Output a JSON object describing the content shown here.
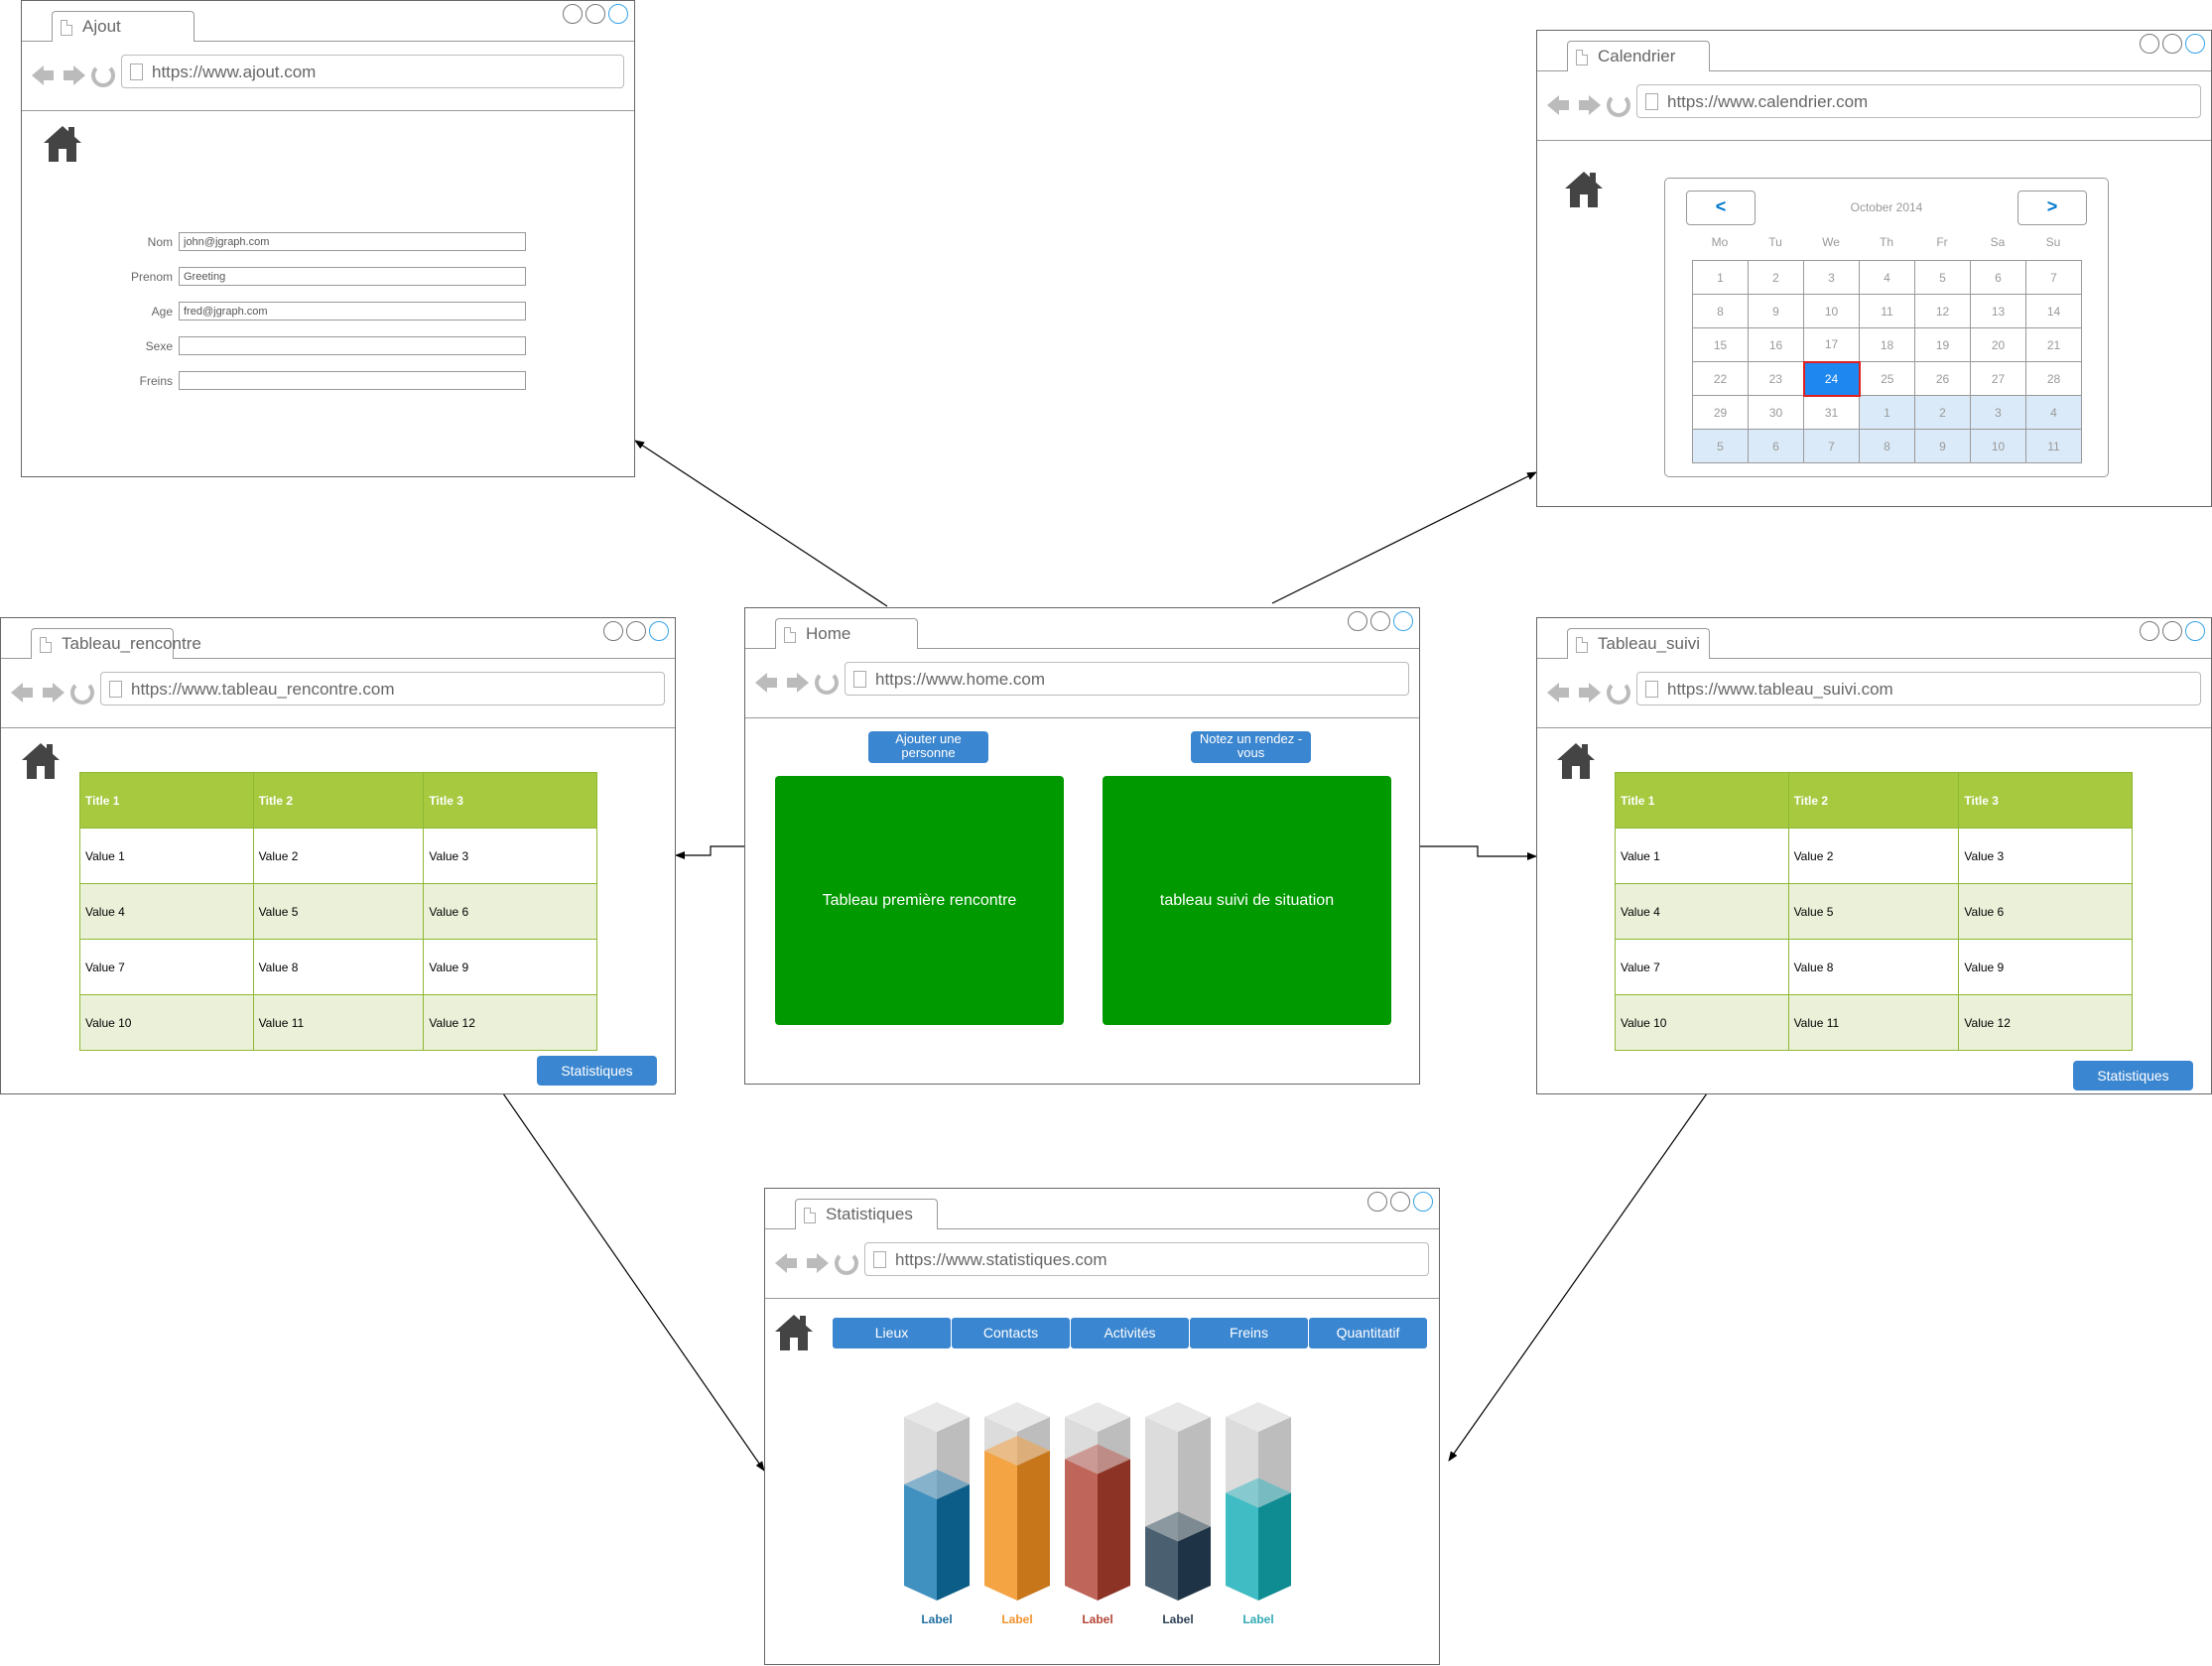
{
  "windows": {
    "ajout": {
      "tab": "Ajout",
      "url": "https://www.ajout.com",
      "form": [
        {
          "label": "Nom",
          "value": "john@jgraph.com"
        },
        {
          "label": "Prenom",
          "value": "Greeting"
        },
        {
          "label": "Age",
          "value": "fred@jgraph.com"
        },
        {
          "label": "Sexe",
          "value": ""
        },
        {
          "label": "Freins",
          "value": ""
        }
      ]
    },
    "calendrier": {
      "tab": "Calendrier",
      "url": "https://www.calendrier.com",
      "prev": "<",
      "next": ">",
      "month": "October 2014",
      "weekdays": [
        "Mo",
        "Tu",
        "We",
        "Th",
        "Fr",
        "Sa",
        "Su"
      ],
      "weeks": [
        [
          "1",
          "2",
          "3",
          "4",
          "5",
          "6",
          "7"
        ],
        [
          "8",
          "9",
          "10",
          "11",
          "12",
          "13",
          "14"
        ],
        [
          "15",
          "16",
          "17",
          "18",
          "19",
          "20",
          "21"
        ],
        [
          "22",
          "23",
          "24",
          "25",
          "26",
          "27",
          "28"
        ],
        [
          "29",
          "30",
          "31",
          "1",
          "2",
          "3",
          "4"
        ],
        [
          "5",
          "6",
          "7",
          "8",
          "9",
          "10",
          "11"
        ]
      ],
      "selected": "24"
    },
    "tableau_rencontre": {
      "tab": "Tableau_rencontre",
      "url": "https://www.tableau_rencontre.com",
      "headers": [
        "Title 1",
        "Title 2",
        "Title 3"
      ],
      "rows": [
        [
          "Value 1",
          "Value 2",
          "Value 3"
        ],
        [
          "Value 4",
          "Value 5",
          "Value 6"
        ],
        [
          "Value 7",
          "Value 8",
          "Value 9"
        ],
        [
          "Value 10",
          "Value 11",
          "Value 12"
        ]
      ],
      "button": "Statistiques"
    },
    "home": {
      "tab": "Home",
      "url": "https://www.home.com",
      "button_left": "Ajouter une personne",
      "button_right": "Notez un rendez -vous",
      "card_left": "Tableau première rencontre",
      "card_right": "tableau suivi de situation"
    },
    "tableau_suivi": {
      "tab": "Tableau_suivi",
      "url": "https://www.tableau_suivi.com",
      "headers": [
        "Title 1",
        "Title 2",
        "Title 3"
      ],
      "rows": [
        [
          "Value 1",
          "Value 2",
          "Value 3"
        ],
        [
          "Value 4",
          "Value 5",
          "Value 6"
        ],
        [
          "Value 7",
          "Value 8",
          "Value 9"
        ],
        [
          "Value 10",
          "Value 11",
          "Value 12"
        ]
      ],
      "button": "Statistiques"
    },
    "statistiques": {
      "tab": "Statistiques",
      "url": "https://www.statistiques.com",
      "tabs": [
        "Lieux",
        "Contacts",
        "Activités",
        "Freins",
        "Quantitatif"
      ]
    }
  },
  "chart_data": {
    "type": "bar",
    "categories": [
      "Label",
      "Label",
      "Label",
      "Label",
      "Label"
    ],
    "values": [
      0.6,
      0.8,
      0.75,
      0.35,
      0.55
    ],
    "colors": {
      "front": [
        "#4090c0",
        "#f5a444",
        "#c0655a",
        "#4a6070",
        "#40bcc4"
      ],
      "side": [
        "#0c5e88",
        "#c8761a",
        "#8c3325",
        "#1e3345",
        "#0e8c92"
      ],
      "label": [
        "#1f6fa0",
        "#f0922c",
        "#b34535",
        "#2e4155",
        "#30aab4"
      ]
    },
    "ylim": [
      0,
      1
    ]
  },
  "colors": {
    "accent": "#3b86d0",
    "green_card": "#009900",
    "table_header": "#a7c940",
    "table_alt_row": "#eaf1d8",
    "calendar_selected": "#1e88f0",
    "calendar_next_month": "#dbeaf8"
  }
}
